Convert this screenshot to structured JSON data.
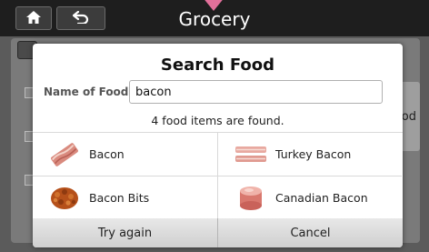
{
  "app": {
    "title": "Grocery",
    "accent_color": "#e2709a"
  },
  "toolbar": {
    "home_icon": "home-icon",
    "back_icon": "back-arrow-icon"
  },
  "background": {
    "side_button_label": "od"
  },
  "dialog": {
    "title": "Search Food",
    "name_label": "Name of Food",
    "name_value": "bacon",
    "result_text": "4 food items are found.",
    "items": [
      {
        "label": "Bacon",
        "icon": "bacon-strip-icon"
      },
      {
        "label": "Turkey Bacon",
        "icon": "turkey-bacon-icon"
      },
      {
        "label": "Bacon Bits",
        "icon": "bacon-bits-icon"
      },
      {
        "label": "Canadian Bacon",
        "icon": "canadian-bacon-icon"
      }
    ],
    "buttons": {
      "try_again": "Try again",
      "cancel": "Cancel"
    }
  }
}
